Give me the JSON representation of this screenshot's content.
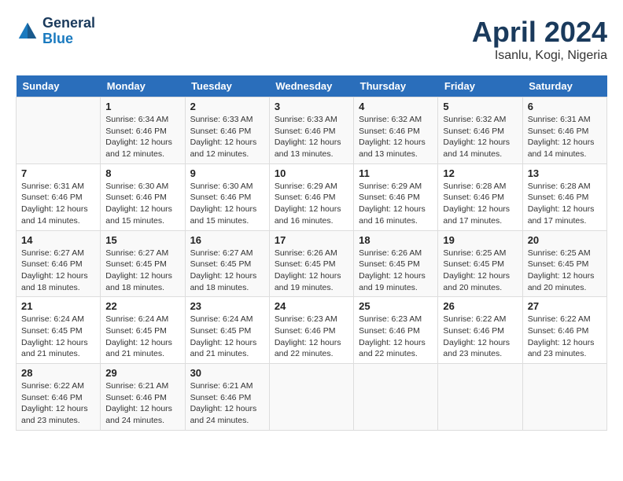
{
  "header": {
    "logo_general": "General",
    "logo_blue": "Blue",
    "month_title": "April 2024",
    "location": "Isanlu, Kogi, Nigeria"
  },
  "weekdays": [
    "Sunday",
    "Monday",
    "Tuesday",
    "Wednesday",
    "Thursday",
    "Friday",
    "Saturday"
  ],
  "weeks": [
    [
      {
        "day": "",
        "sunrise": "",
        "sunset": "",
        "daylight": ""
      },
      {
        "day": "1",
        "sunrise": "Sunrise: 6:34 AM",
        "sunset": "Sunset: 6:46 PM",
        "daylight": "Daylight: 12 hours and 12 minutes."
      },
      {
        "day": "2",
        "sunrise": "Sunrise: 6:33 AM",
        "sunset": "Sunset: 6:46 PM",
        "daylight": "Daylight: 12 hours and 12 minutes."
      },
      {
        "day": "3",
        "sunrise": "Sunrise: 6:33 AM",
        "sunset": "Sunset: 6:46 PM",
        "daylight": "Daylight: 12 hours and 13 minutes."
      },
      {
        "day": "4",
        "sunrise": "Sunrise: 6:32 AM",
        "sunset": "Sunset: 6:46 PM",
        "daylight": "Daylight: 12 hours and 13 minutes."
      },
      {
        "day": "5",
        "sunrise": "Sunrise: 6:32 AM",
        "sunset": "Sunset: 6:46 PM",
        "daylight": "Daylight: 12 hours and 14 minutes."
      },
      {
        "day": "6",
        "sunrise": "Sunrise: 6:31 AM",
        "sunset": "Sunset: 6:46 PM",
        "daylight": "Daylight: 12 hours and 14 minutes."
      }
    ],
    [
      {
        "day": "7",
        "sunrise": "Sunrise: 6:31 AM",
        "sunset": "Sunset: 6:46 PM",
        "daylight": "Daylight: 12 hours and 14 minutes."
      },
      {
        "day": "8",
        "sunrise": "Sunrise: 6:30 AM",
        "sunset": "Sunset: 6:46 PM",
        "daylight": "Daylight: 12 hours and 15 minutes."
      },
      {
        "day": "9",
        "sunrise": "Sunrise: 6:30 AM",
        "sunset": "Sunset: 6:46 PM",
        "daylight": "Daylight: 12 hours and 15 minutes."
      },
      {
        "day": "10",
        "sunrise": "Sunrise: 6:29 AM",
        "sunset": "Sunset: 6:46 PM",
        "daylight": "Daylight: 12 hours and 16 minutes."
      },
      {
        "day": "11",
        "sunrise": "Sunrise: 6:29 AM",
        "sunset": "Sunset: 6:46 PM",
        "daylight": "Daylight: 12 hours and 16 minutes."
      },
      {
        "day": "12",
        "sunrise": "Sunrise: 6:28 AM",
        "sunset": "Sunset: 6:46 PM",
        "daylight": "Daylight: 12 hours and 17 minutes."
      },
      {
        "day": "13",
        "sunrise": "Sunrise: 6:28 AM",
        "sunset": "Sunset: 6:46 PM",
        "daylight": "Daylight: 12 hours and 17 minutes."
      }
    ],
    [
      {
        "day": "14",
        "sunrise": "Sunrise: 6:27 AM",
        "sunset": "Sunset: 6:46 PM",
        "daylight": "Daylight: 12 hours and 18 minutes."
      },
      {
        "day": "15",
        "sunrise": "Sunrise: 6:27 AM",
        "sunset": "Sunset: 6:45 PM",
        "daylight": "Daylight: 12 hours and 18 minutes."
      },
      {
        "day": "16",
        "sunrise": "Sunrise: 6:27 AM",
        "sunset": "Sunset: 6:45 PM",
        "daylight": "Daylight: 12 hours and 18 minutes."
      },
      {
        "day": "17",
        "sunrise": "Sunrise: 6:26 AM",
        "sunset": "Sunset: 6:45 PM",
        "daylight": "Daylight: 12 hours and 19 minutes."
      },
      {
        "day": "18",
        "sunrise": "Sunrise: 6:26 AM",
        "sunset": "Sunset: 6:45 PM",
        "daylight": "Daylight: 12 hours and 19 minutes."
      },
      {
        "day": "19",
        "sunrise": "Sunrise: 6:25 AM",
        "sunset": "Sunset: 6:45 PM",
        "daylight": "Daylight: 12 hours and 20 minutes."
      },
      {
        "day": "20",
        "sunrise": "Sunrise: 6:25 AM",
        "sunset": "Sunset: 6:45 PM",
        "daylight": "Daylight: 12 hours and 20 minutes."
      }
    ],
    [
      {
        "day": "21",
        "sunrise": "Sunrise: 6:24 AM",
        "sunset": "Sunset: 6:45 PM",
        "daylight": "Daylight: 12 hours and 21 minutes."
      },
      {
        "day": "22",
        "sunrise": "Sunrise: 6:24 AM",
        "sunset": "Sunset: 6:45 PM",
        "daylight": "Daylight: 12 hours and 21 minutes."
      },
      {
        "day": "23",
        "sunrise": "Sunrise: 6:24 AM",
        "sunset": "Sunset: 6:45 PM",
        "daylight": "Daylight: 12 hours and 21 minutes."
      },
      {
        "day": "24",
        "sunrise": "Sunrise: 6:23 AM",
        "sunset": "Sunset: 6:46 PM",
        "daylight": "Daylight: 12 hours and 22 minutes."
      },
      {
        "day": "25",
        "sunrise": "Sunrise: 6:23 AM",
        "sunset": "Sunset: 6:46 PM",
        "daylight": "Daylight: 12 hours and 22 minutes."
      },
      {
        "day": "26",
        "sunrise": "Sunrise: 6:22 AM",
        "sunset": "Sunset: 6:46 PM",
        "daylight": "Daylight: 12 hours and 23 minutes."
      },
      {
        "day": "27",
        "sunrise": "Sunrise: 6:22 AM",
        "sunset": "Sunset: 6:46 PM",
        "daylight": "Daylight: 12 hours and 23 minutes."
      }
    ],
    [
      {
        "day": "28",
        "sunrise": "Sunrise: 6:22 AM",
        "sunset": "Sunset: 6:46 PM",
        "daylight": "Daylight: 12 hours and 23 minutes."
      },
      {
        "day": "29",
        "sunrise": "Sunrise: 6:21 AM",
        "sunset": "Sunset: 6:46 PM",
        "daylight": "Daylight: 12 hours and 24 minutes."
      },
      {
        "day": "30",
        "sunrise": "Sunrise: 6:21 AM",
        "sunset": "Sunset: 6:46 PM",
        "daylight": "Daylight: 12 hours and 24 minutes."
      },
      {
        "day": "",
        "sunrise": "",
        "sunset": "",
        "daylight": ""
      },
      {
        "day": "",
        "sunrise": "",
        "sunset": "",
        "daylight": ""
      },
      {
        "day": "",
        "sunrise": "",
        "sunset": "",
        "daylight": ""
      },
      {
        "day": "",
        "sunrise": "",
        "sunset": "",
        "daylight": ""
      }
    ]
  ]
}
